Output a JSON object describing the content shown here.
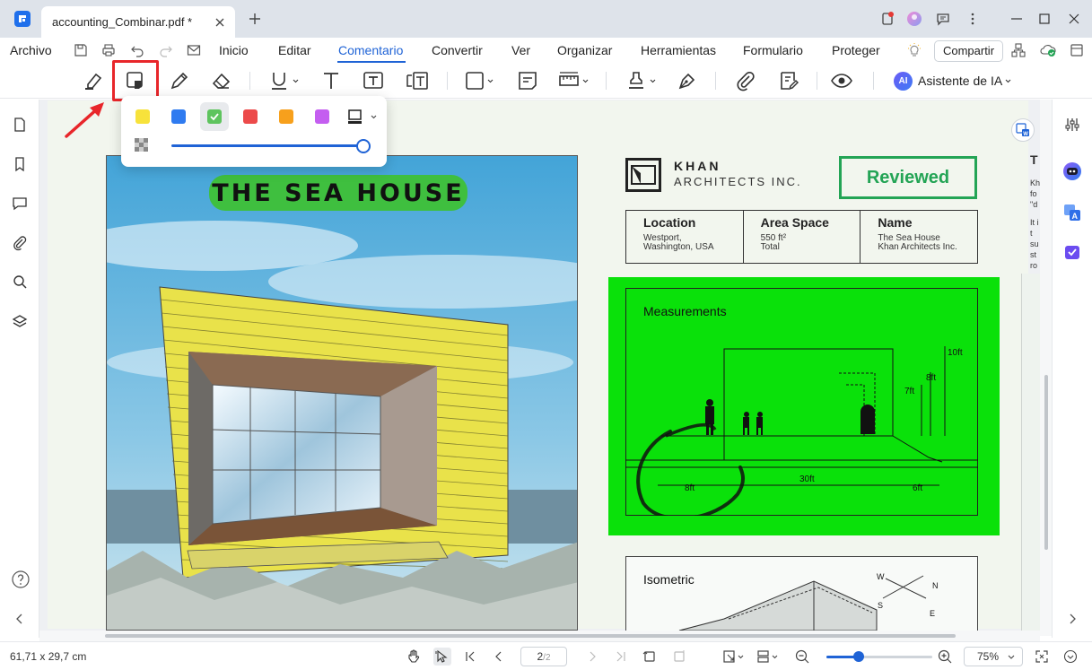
{
  "window": {
    "tab_title": "accounting_Combinar.pdf *"
  },
  "menu": {
    "archivo": "Archivo",
    "items": [
      "Inicio",
      "Editar",
      "Comentario",
      "Convertir",
      "Ver",
      "Organizar",
      "Herramientas",
      "Formulario",
      "Proteger"
    ],
    "active": "Comentario",
    "share_label": "Compartir"
  },
  "toolbar": {
    "ai_label": "Asistente de IA",
    "ai_badge": "AI"
  },
  "palette": {
    "colors": [
      "#f7e23b",
      "#2f7bf0",
      "#5ec45e",
      "#ec4a4a",
      "#f7a01c",
      "#c45ef0"
    ],
    "selected_index": 2,
    "opacity": 1.0
  },
  "document": {
    "poster_title": "THE SEA HOUSE",
    "company_name": "KHAN",
    "company_sub": "ARCHITECTS INC.",
    "stamp": "Reviewed",
    "info": [
      {
        "head": "Location",
        "line1": "Westport,",
        "line2": "Washington, USA"
      },
      {
        "head": "Area Space",
        "line1": "550 ft²",
        "line2": "Total"
      },
      {
        "head": "Name",
        "line1": "The Sea House",
        "line2": "Khan Architects Inc."
      }
    ],
    "measurements_title": "Measurements",
    "dimensions": {
      "h1": "10ft",
      "h2": "8ft",
      "h3": "7ft",
      "w1": "8ft",
      "w2": "30ft",
      "w3": "6ft"
    },
    "isometric_title": "Isometric",
    "compass": {
      "w": "W",
      "n": "N",
      "s": "S",
      "e": "E"
    },
    "edge_text": [
      "T",
      "Kh",
      "fo",
      "\"d",
      "It i",
      "t",
      "su",
      "st",
      "ro"
    ]
  },
  "status": {
    "dimensions": "61,71 x 29,7 cm",
    "page_current": "2",
    "page_total": "/2",
    "zoom": "75%"
  },
  "colors": {
    "accent": "#1f63d6",
    "highlight_green": "#0ae10a",
    "stamp_green": "#23a455",
    "annotation_red": "#e8262a"
  }
}
